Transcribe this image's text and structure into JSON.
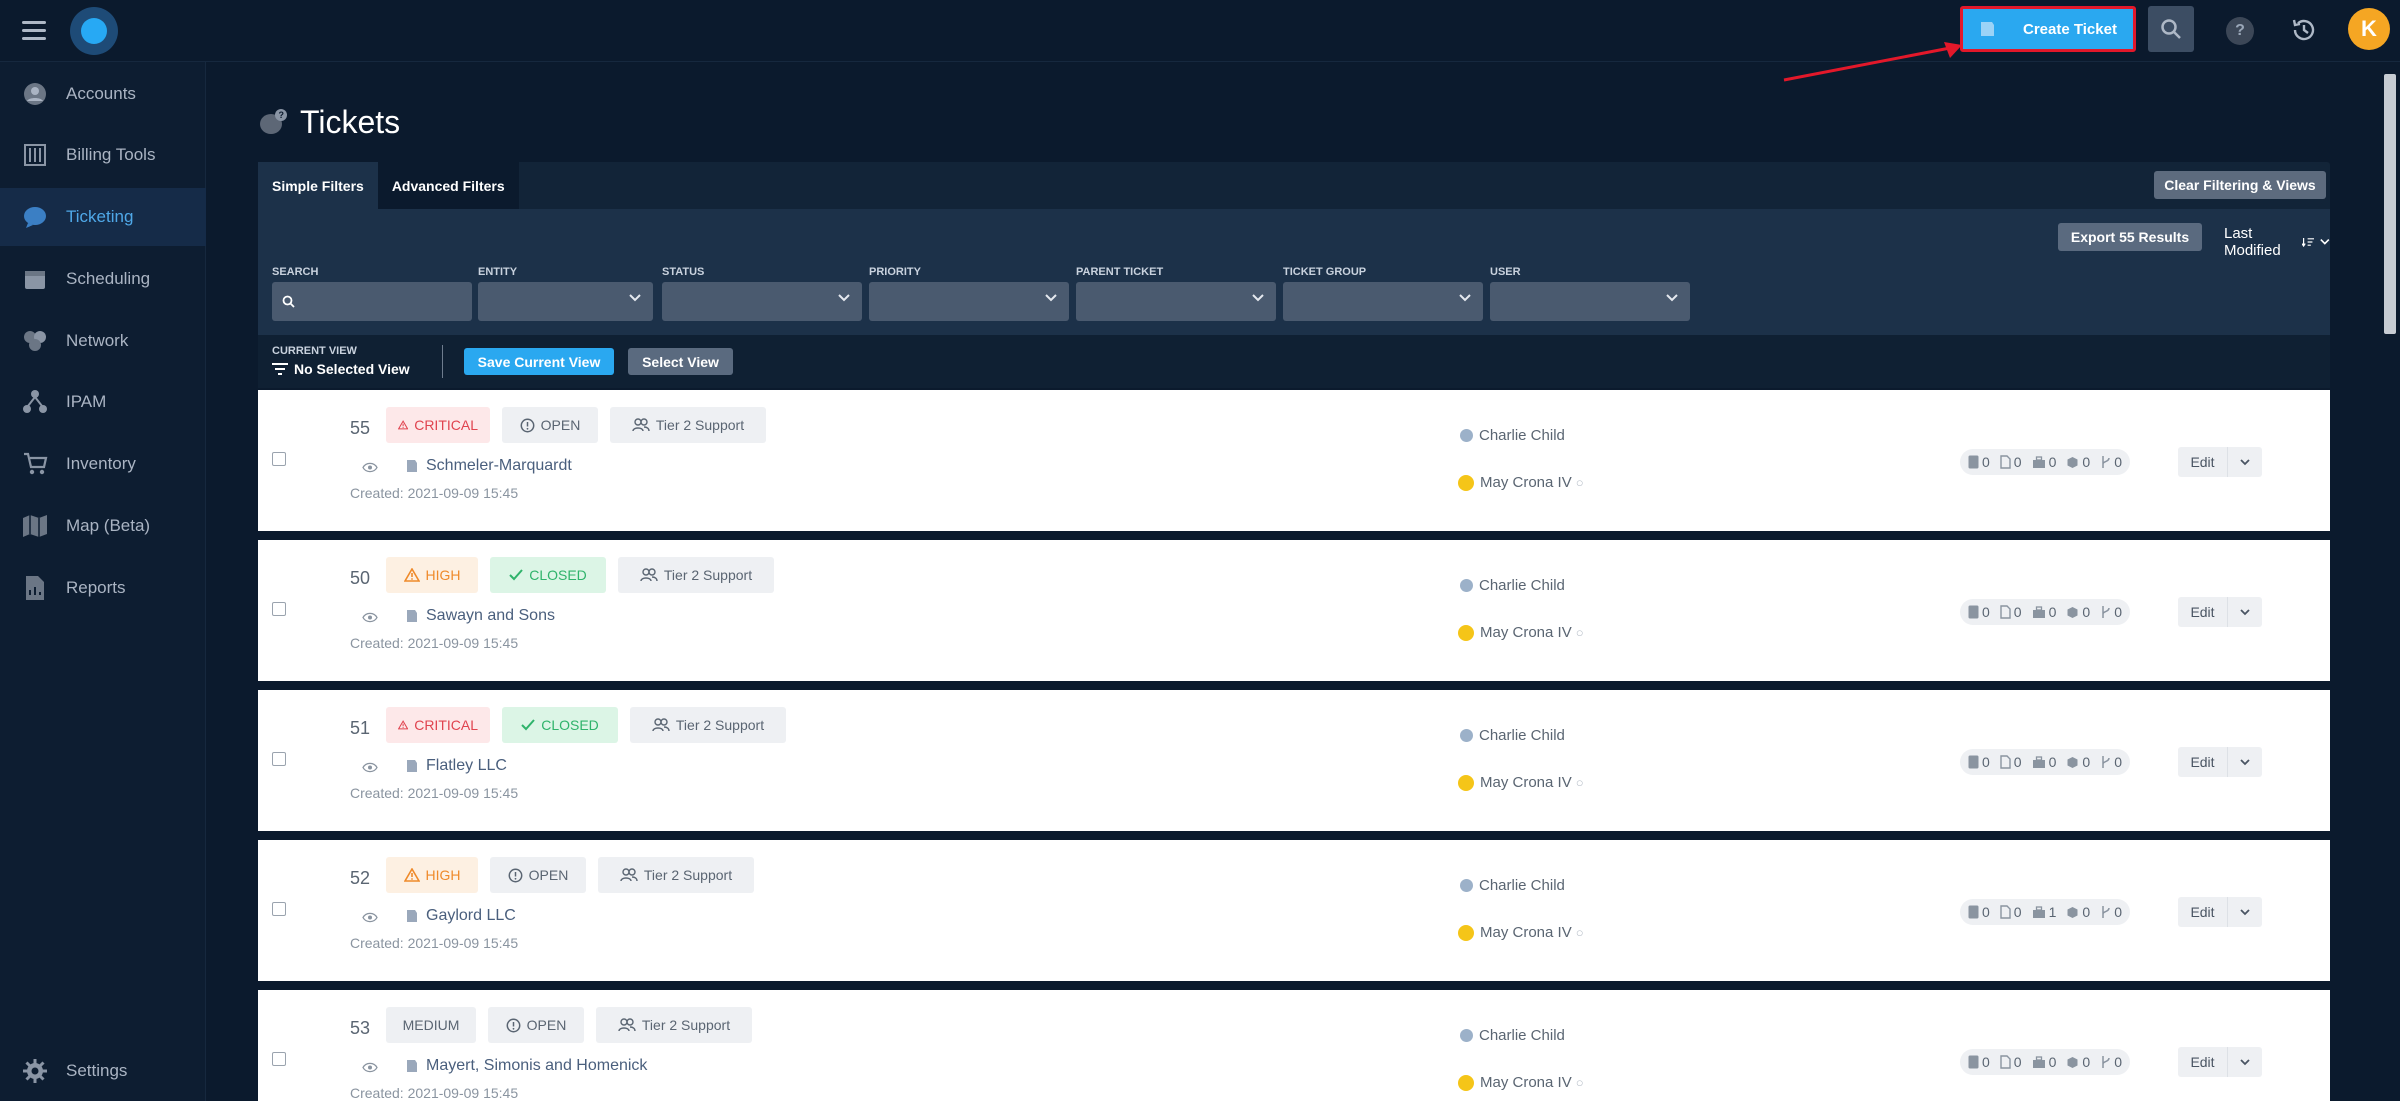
{
  "topbar": {
    "create_ticket_label": "Create Ticket",
    "help_label": "?",
    "avatar_initial": "K"
  },
  "sidebar": {
    "items": [
      {
        "label": "Accounts",
        "icon": "accounts-icon"
      },
      {
        "label": "Billing Tools",
        "icon": "billing-icon"
      },
      {
        "label": "Ticketing",
        "icon": "ticketing-icon",
        "active": true
      },
      {
        "label": "Scheduling",
        "icon": "calendar-icon"
      },
      {
        "label": "Network",
        "icon": "network-icon"
      },
      {
        "label": "IPAM",
        "icon": "ipam-icon"
      },
      {
        "label": "Inventory",
        "icon": "cart-icon"
      },
      {
        "label": "Map (Beta)",
        "icon": "map-icon"
      },
      {
        "label": "Reports",
        "icon": "report-icon"
      }
    ],
    "settings_label": "Settings"
  },
  "page": {
    "title": "Tickets"
  },
  "filters": {
    "tabs": [
      "Simple Filters",
      "Advanced Filters"
    ],
    "clear_label": "Clear Filtering & Views",
    "export_label": "Export 55 Results",
    "sort_label": "Last Modified",
    "fields": [
      "SEARCH",
      "ENTITY",
      "STATUS",
      "PRIORITY",
      "PARENT TICKET",
      "TICKET GROUP",
      "USER"
    ],
    "current_view_label": "CURRENT VIEW",
    "current_view_value": "No Selected View",
    "save_view_label": "Save Current View",
    "select_view_label": "Select View"
  },
  "tickets": [
    {
      "id": "55",
      "priority": "CRITICAL",
      "status": "OPEN",
      "group": "Tier 2 Support",
      "entity": "Schmeler-Marquardt",
      "created": "Created: 2021-09-09 15:45",
      "person1": "Charlie Child",
      "person2": "May Crona IV",
      "counts": [
        "0",
        "0",
        "0",
        "0",
        "0"
      ],
      "edit": "Edit"
    },
    {
      "id": "50",
      "priority": "HIGH",
      "status": "CLOSED",
      "group": "Tier 2 Support",
      "entity": "Sawayn and Sons",
      "created": "Created: 2021-09-09 15:45",
      "person1": "Charlie Child",
      "person2": "May Crona IV",
      "counts": [
        "0",
        "0",
        "0",
        "0",
        "0"
      ],
      "edit": "Edit"
    },
    {
      "id": "51",
      "priority": "CRITICAL",
      "status": "CLOSED",
      "group": "Tier 2 Support",
      "entity": "Flatley LLC",
      "created": "Created: 2021-09-09 15:45",
      "person1": "Charlie Child",
      "person2": "May Crona IV",
      "counts": [
        "0",
        "0",
        "0",
        "0",
        "0"
      ],
      "edit": "Edit"
    },
    {
      "id": "52",
      "priority": "HIGH",
      "status": "OPEN",
      "group": "Tier 2 Support",
      "entity": "Gaylord LLC",
      "created": "Created: 2021-09-09 15:45",
      "person1": "Charlie Child",
      "person2": "May Crona IV",
      "counts": [
        "0",
        "0",
        "1",
        "0",
        "0"
      ],
      "edit": "Edit"
    },
    {
      "id": "53",
      "priority": "MEDIUM",
      "status": "OPEN",
      "group": "Tier 2 Support",
      "entity": "Mayert, Simonis and Homenick",
      "created": "Created: 2021-09-09 15:45",
      "person1": "Charlie Child",
      "person2": "May Crona IV",
      "counts": [
        "0",
        "0",
        "0",
        "0",
        "0"
      ],
      "edit": "Edit"
    }
  ],
  "colors": {
    "accent": "#2aa8f0",
    "annotation": "#e3182a",
    "critical": "#e0434f",
    "high": "#ef8a2a",
    "closed": "#2fb36b"
  }
}
